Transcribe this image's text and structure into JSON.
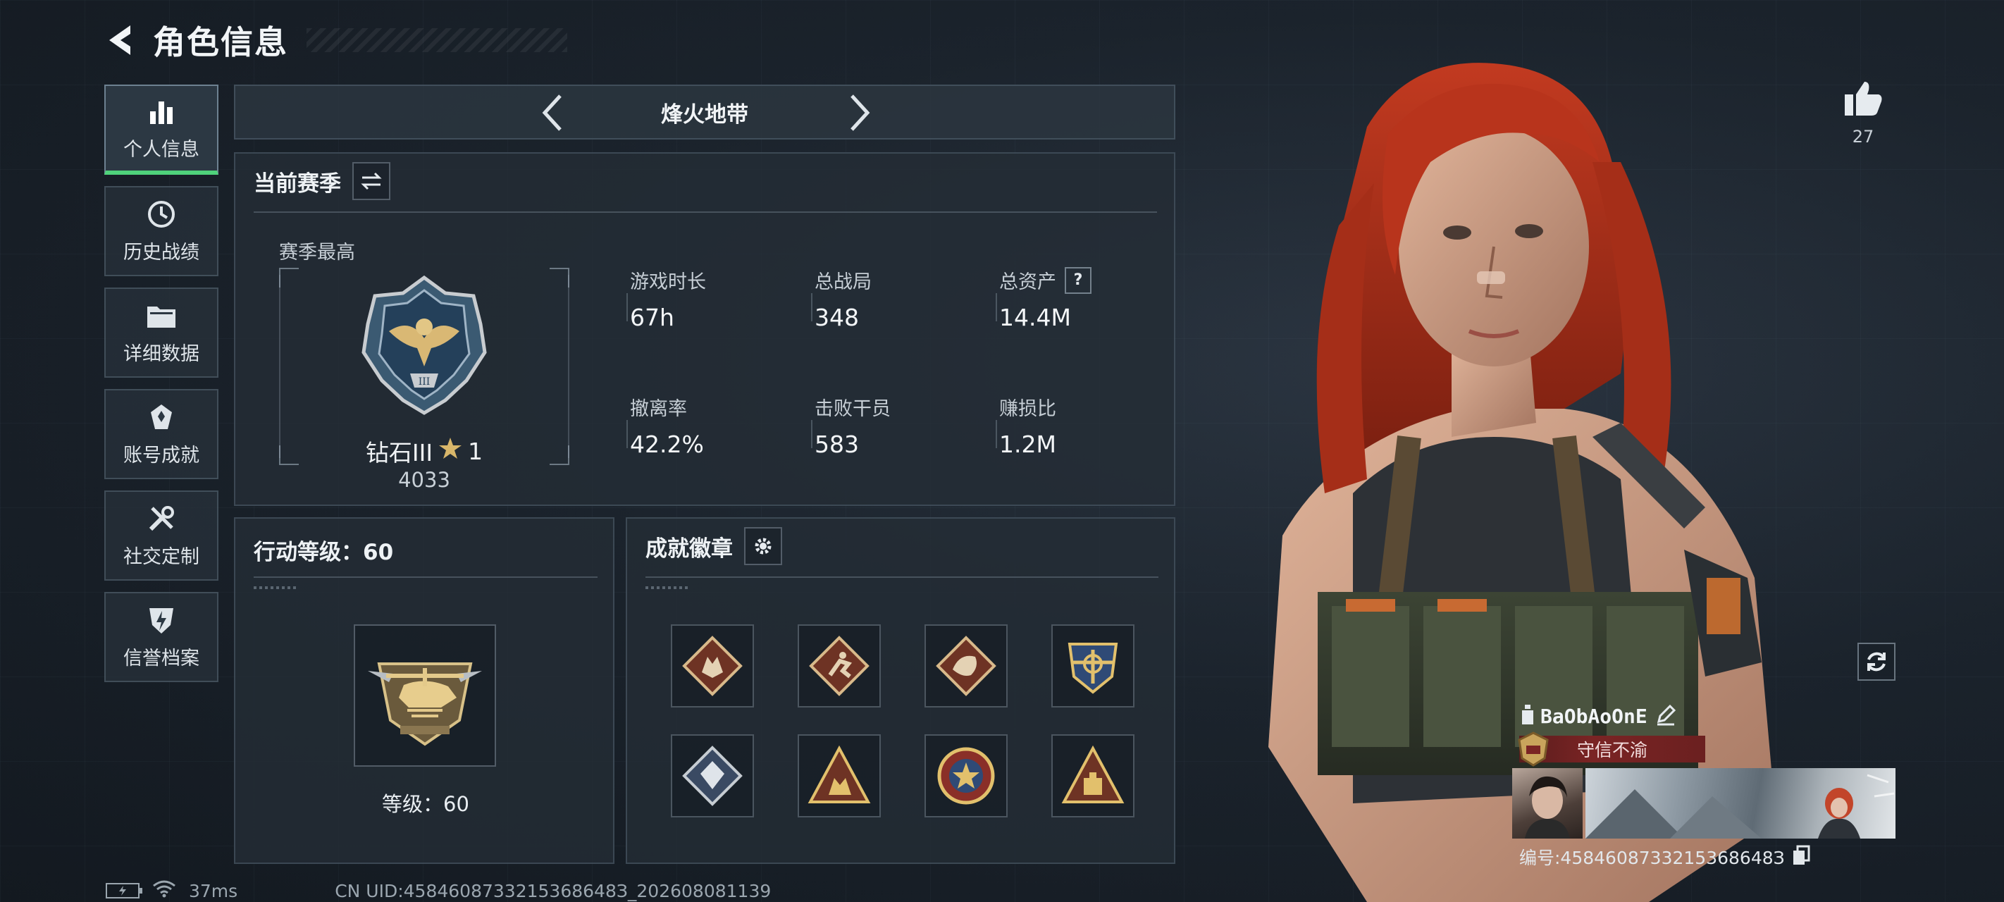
{
  "header": {
    "title": "角色信息"
  },
  "sidebar": {
    "items": [
      {
        "label": "个人信息",
        "icon": "bar-chart-icon",
        "active": true
      },
      {
        "label": "历史战绩",
        "icon": "history-icon",
        "active": false
      },
      {
        "label": "详细数据",
        "icon": "folder-icon",
        "active": false
      },
      {
        "label": "账号成就",
        "icon": "achievement-icon",
        "active": false
      },
      {
        "label": "社交定制",
        "icon": "tools-icon",
        "active": false
      },
      {
        "label": "信誉档案",
        "icon": "credit-shield-icon",
        "active": false
      }
    ]
  },
  "mode": {
    "title": "烽火地带"
  },
  "season": {
    "title": "当前赛季",
    "best_label": "赛季最高",
    "rank_name": "钻石III",
    "rank_stars": "1",
    "rank_points": "4033",
    "stats": [
      {
        "label": "游戏时长",
        "value": "67h"
      },
      {
        "label": "总战局",
        "value": "348"
      },
      {
        "label": "总资产",
        "value": "14.4M",
        "has_help": true
      },
      {
        "label": "撤离率",
        "value": "42.2%"
      },
      {
        "label": "击败干员",
        "value": "583"
      },
      {
        "label": "赚损比",
        "value": "1.2M"
      }
    ],
    "help_symbol": "?"
  },
  "action_level": {
    "title": "行动等级：60",
    "level_text": "等级：60"
  },
  "achievements": {
    "title": "成就徽章",
    "badges": [
      "wolf-badge-icon",
      "runner-badge-icon",
      "dragon-badge-icon",
      "wings-emblem-icon",
      "diamond-crest-icon",
      "soldiers-triangle-icon",
      "star-medal-icon",
      "crate-triangle-icon"
    ]
  },
  "social": {
    "like_count": "27"
  },
  "player": {
    "name": "BaObAoOnE",
    "title_banner": "守信不渝",
    "uid_text": "编号:4584608733215368648З"
  },
  "footer": {
    "ping": "37ms",
    "server_uid": "CN UID:4584608733215368648З_202608081139"
  },
  "colors": {
    "accent_green": "#4fd27b",
    "banner_red": "#7a2424",
    "gold": "#c9a45c"
  }
}
